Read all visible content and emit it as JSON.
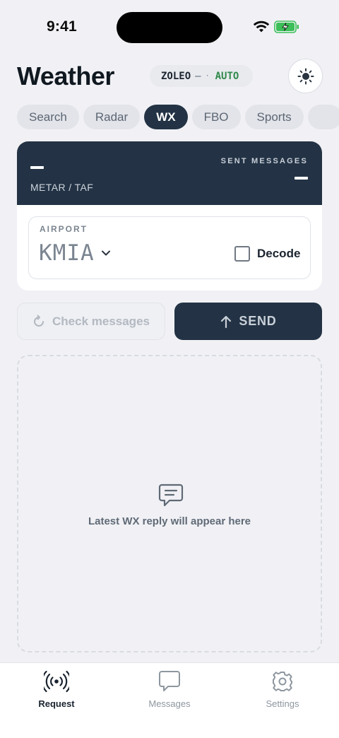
{
  "status_bar": {
    "time": "9:41"
  },
  "header": {
    "title": "Weather",
    "device_name": "ZOLEO",
    "device_status": "—",
    "device_dot": "·",
    "device_mode": "AUTO"
  },
  "tabs": [
    {
      "label": "Search"
    },
    {
      "label": "Radar"
    },
    {
      "label": "WX",
      "active": true
    },
    {
      "label": "FBO"
    },
    {
      "label": "Sports"
    }
  ],
  "card": {
    "request_type": "METAR / TAF",
    "sent_messages_label": "SENT MESSAGES",
    "airport_label": "AIRPORT",
    "airport_value": "KMIA",
    "decode_label": "Decode",
    "decode_checked": false
  },
  "actions": {
    "check_label": "Check messages",
    "send_label": "SEND"
  },
  "reply": {
    "placeholder": "Latest WX reply will appear here"
  },
  "tab_bar": {
    "items": [
      {
        "label": "Request",
        "icon": "broadcast-icon",
        "active": true
      },
      {
        "label": "Messages",
        "icon": "chat-icon"
      },
      {
        "label": "Settings",
        "icon": "gear-icon"
      }
    ]
  },
  "colors": {
    "accent_dark": "#233345",
    "auto_green": "#2f8a4c",
    "background": "#f1f1f5"
  }
}
